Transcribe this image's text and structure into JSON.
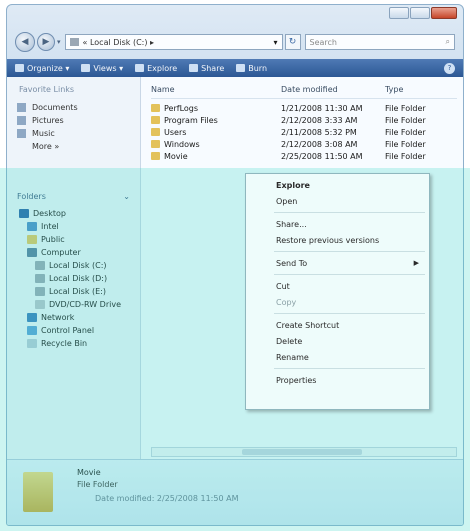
{
  "window": {
    "caption_buttons": [
      "minimize",
      "maximize",
      "close"
    ]
  },
  "address": {
    "path": "« Local Disk (C:) ▸",
    "search_placeholder": "Search"
  },
  "toolbar": [
    {
      "label": "Organize ▾",
      "icon": "organize-icon"
    },
    {
      "label": "Views ▾",
      "icon": "views-icon"
    },
    {
      "label": "Explore",
      "icon": "explore-icon"
    },
    {
      "label": "Share",
      "icon": "share-icon"
    },
    {
      "label": "Burn",
      "icon": "burn-icon"
    }
  ],
  "favorites": {
    "title": "Favorite Links",
    "items": [
      "Documents",
      "Pictures",
      "Music",
      "More »"
    ]
  },
  "folders_title": "Folders",
  "tree": [
    {
      "label": "Desktop",
      "indent": 0,
      "icon": "desk"
    },
    {
      "label": "Intel",
      "indent": 1,
      "icon": "user"
    },
    {
      "label": "Public",
      "indent": 1,
      "icon": "folder"
    },
    {
      "label": "Computer",
      "indent": 1,
      "icon": "comp"
    },
    {
      "label": "Local Disk (C:)",
      "indent": 2,
      "icon": "drive"
    },
    {
      "label": "Local Disk (D:)",
      "indent": 2,
      "icon": "drive"
    },
    {
      "label": "Local Disk (E:)",
      "indent": 2,
      "icon": "drive"
    },
    {
      "label": "DVD/CD-RW Drive",
      "indent": 2,
      "icon": "dvd"
    },
    {
      "label": "Network",
      "indent": 1,
      "icon": "net"
    },
    {
      "label": "Control Panel",
      "indent": 1,
      "icon": "cp"
    },
    {
      "label": "Recycle Bin",
      "indent": 1,
      "icon": "bin"
    }
  ],
  "columns": {
    "name": "Name",
    "date": "Date modified",
    "type": "Type"
  },
  "files": [
    {
      "name": "PerfLogs",
      "date": "1/21/2008 11:30 AM",
      "type": "File Folder"
    },
    {
      "name": "Program Files",
      "date": "2/12/2008 3:33 AM",
      "type": "File Folder"
    },
    {
      "name": "Users",
      "date": "2/11/2008 5:32 PM",
      "type": "File Folder"
    },
    {
      "name": "Windows",
      "date": "2/12/2008 3:08 AM",
      "type": "File Folder"
    },
    {
      "name": "Movie",
      "date": "2/25/2008 11:50 AM",
      "type": "File Folder"
    }
  ],
  "context_menu": [
    {
      "label": "Explore",
      "bold": true
    },
    {
      "label": "Open"
    },
    {
      "sep": true
    },
    {
      "label": "Share..."
    },
    {
      "label": "Restore previous versions"
    },
    {
      "sep": true
    },
    {
      "label": "Send To",
      "submenu": true
    },
    {
      "sep": true
    },
    {
      "label": "Cut"
    },
    {
      "label": "Copy",
      "disabled": true
    },
    {
      "sep": true
    },
    {
      "label": "Create Shortcut"
    },
    {
      "label": "Delete"
    },
    {
      "label": "Rename"
    },
    {
      "sep": true
    },
    {
      "label": "Properties"
    }
  ],
  "details": {
    "name": "Movie",
    "type": "File Folder",
    "modified": "Date modified: 2/25/2008 11:50 AM"
  },
  "colors": {
    "toolbar": "#2c5794",
    "overlay": "#3cd7c8"
  }
}
